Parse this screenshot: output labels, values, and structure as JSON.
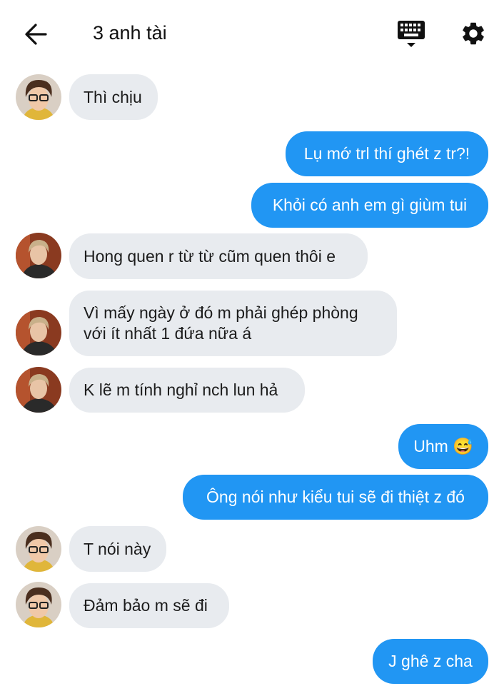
{
  "header": {
    "title": "3 anh tài",
    "back_icon": "arrow-left-icon",
    "keyboard_icon": "keyboard-icon",
    "settings_icon": "gear-icon"
  },
  "colors": {
    "outgoing_bubble": "#2196f3",
    "incoming_bubble": "#e8ebef"
  },
  "messages": [
    {
      "sender": "them",
      "avatar": "glasses",
      "text": "Thì chịu"
    },
    {
      "sender": "me",
      "text": "Lụ mớ trl thí ghét z tr?!"
    },
    {
      "sender": "me",
      "text": "Khỏi có anh em gì giùm tui"
    },
    {
      "sender": "them",
      "avatar": "dark",
      "text": "Hong quen r từ từ cũm quen thôi e"
    },
    {
      "sender": "them",
      "avatar": "dark",
      "line1": "Vì mấy ngày ở đó m phải ghép phòng",
      "line2": "với ít nhất 1 đứa nữa á"
    },
    {
      "sender": "them",
      "avatar": "dark",
      "text": "K lẽ m tính nghỉ nch lun hả"
    },
    {
      "sender": "me",
      "text": "Uhm 😅"
    },
    {
      "sender": "me",
      "text": "Ông nói như kiểu tui sẽ đi thiệt z đó"
    },
    {
      "sender": "them",
      "avatar": "glasses",
      "text": "T nói này"
    },
    {
      "sender": "them",
      "avatar": "glasses",
      "text": "Đảm bảo m sẽ đi"
    },
    {
      "sender": "me",
      "text": "J ghê z cha"
    }
  ]
}
